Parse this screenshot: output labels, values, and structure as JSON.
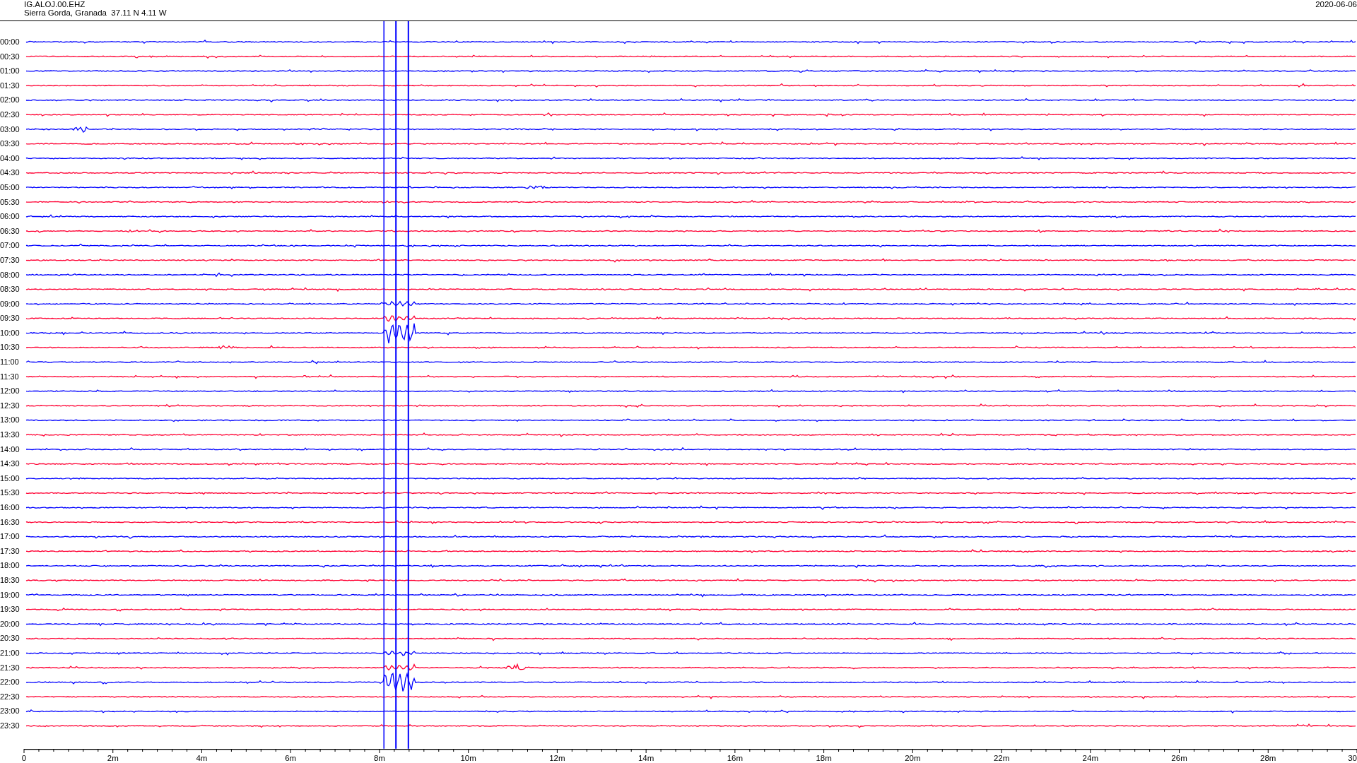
{
  "header": {
    "station": "IG.ALOJ.00.EHZ",
    "location": "Sierra Gorda, Granada  37.11 N 4.11 W",
    "date": "2020-06-06"
  },
  "rows": [
    {
      "time": "00:00",
      "color": "#0000ff"
    },
    {
      "time": "00:30",
      "color": "#ff0033"
    },
    {
      "time": "01:00",
      "color": "#0000ff"
    },
    {
      "time": "01:30",
      "color": "#ff0033"
    },
    {
      "time": "02:00",
      "color": "#0000ff"
    },
    {
      "time": "02:30",
      "color": "#ff0033"
    },
    {
      "time": "03:00",
      "color": "#0000ff"
    },
    {
      "time": "03:30",
      "color": "#ff0033"
    },
    {
      "time": "04:00",
      "color": "#0000ff"
    },
    {
      "time": "04:30",
      "color": "#ff0033"
    },
    {
      "time": "05:00",
      "color": "#0000ff"
    },
    {
      "time": "05:30",
      "color": "#ff0033"
    },
    {
      "time": "06:00",
      "color": "#0000ff"
    },
    {
      "time": "06:30",
      "color": "#ff0033"
    },
    {
      "time": "07:00",
      "color": "#0000ff"
    },
    {
      "time": "07:30",
      "color": "#ff0033"
    },
    {
      "time": "08:00",
      "color": "#0000ff"
    },
    {
      "time": "08:30",
      "color": "#ff0033"
    },
    {
      "time": "09:00",
      "color": "#0000ff"
    },
    {
      "time": "09:30",
      "color": "#ff0033"
    },
    {
      "time": "10:00",
      "color": "#0000ff"
    },
    {
      "time": "10:30",
      "color": "#ff0033"
    },
    {
      "time": "11:00",
      "color": "#0000ff"
    },
    {
      "time": "11:30",
      "color": "#ff0033"
    },
    {
      "time": "12:00",
      "color": "#0000ff"
    },
    {
      "time": "12:30",
      "color": "#ff0033"
    },
    {
      "time": "13:00",
      "color": "#0000ff"
    },
    {
      "time": "13:30",
      "color": "#ff0033"
    },
    {
      "time": "14:00",
      "color": "#0000ff"
    },
    {
      "time": "14:30",
      "color": "#ff0033"
    },
    {
      "time": "15:00",
      "color": "#0000ff"
    },
    {
      "time": "15:30",
      "color": "#ff0033"
    },
    {
      "time": "16:00",
      "color": "#0000ff"
    },
    {
      "time": "16:30",
      "color": "#ff0033"
    },
    {
      "time": "17:00",
      "color": "#0000ff"
    },
    {
      "time": "17:30",
      "color": "#ff0033"
    },
    {
      "time": "18:00",
      "color": "#0000ff"
    },
    {
      "time": "18:30",
      "color": "#ff0033"
    },
    {
      "time": "19:00",
      "color": "#0000ff"
    },
    {
      "time": "19:30",
      "color": "#ff0033"
    },
    {
      "time": "20:00",
      "color": "#0000ff"
    },
    {
      "time": "20:30",
      "color": "#ff0033"
    },
    {
      "time": "21:00",
      "color": "#0000ff"
    },
    {
      "time": "21:30",
      "color": "#ff0033"
    },
    {
      "time": "22:00",
      "color": "#0000ff"
    },
    {
      "time": "22:30",
      "color": "#ff0033"
    },
    {
      "time": "23:00",
      "color": "#0000ff"
    },
    {
      "time": "23:30",
      "color": "#ff0033"
    }
  ],
  "time_axis": {
    "labels": [
      "0",
      "2m",
      "4m",
      "6m",
      "8m",
      "10m",
      "12m",
      "14m",
      "16m",
      "18m",
      "20m",
      "22m",
      "24m",
      "26m",
      "28m",
      "30"
    ]
  }
}
